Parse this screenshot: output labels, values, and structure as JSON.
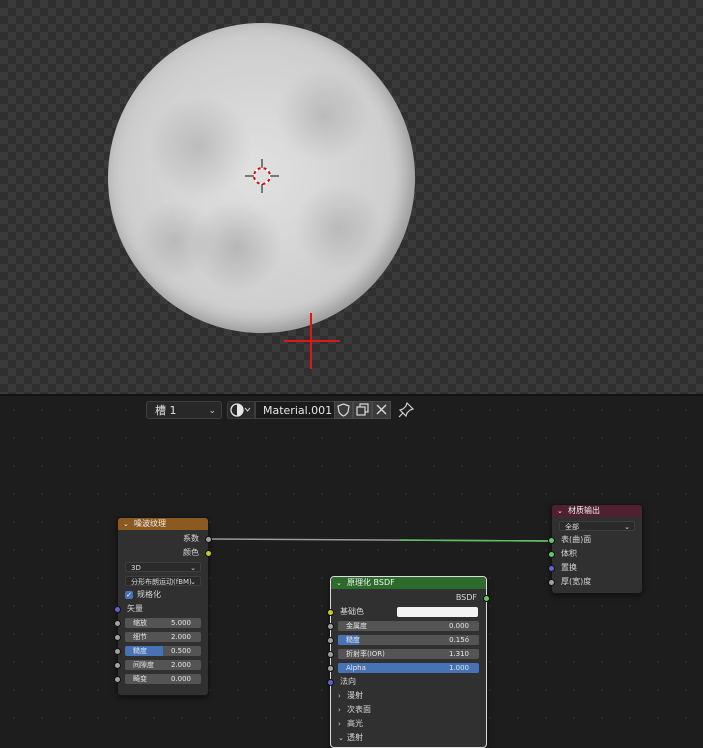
{
  "header": {
    "slot_label": "槽 1",
    "material_name": "Material.001"
  },
  "noise_node": {
    "title": "噪波纹理",
    "outputs": [
      "系数",
      "颜色"
    ],
    "dimension": "3D",
    "noise_type": "分形布朗运动(fBM)",
    "normalize_label": "规格化",
    "normalize_checked": true,
    "vector_label": "矢量",
    "fields": [
      {
        "label": "缩放",
        "value": "5.000"
      },
      {
        "label": "细节",
        "value": "2.000"
      },
      {
        "label": "糙度",
        "value": "0.500",
        "fill": 0.5
      },
      {
        "label": "间隙度",
        "value": "2.000"
      },
      {
        "label": "畸变",
        "value": "0.000"
      }
    ]
  },
  "bsdf_node": {
    "title": "原理化 BSDF",
    "output": "BSDF",
    "base_color_label": "基础色",
    "fields": [
      {
        "label": "金属度",
        "value": "0.000"
      },
      {
        "label": "糙度",
        "value": "0.15ó",
        "fill": 0.15
      },
      {
        "label": "折射率(IOR)",
        "value": "1.310"
      },
      {
        "label": "Alpha",
        "value": "1.000",
        "fill": 1.0
      }
    ],
    "normal_label": "法向",
    "subpanels": [
      "漫射",
      "次表面",
      "高光",
      "透射"
    ]
  },
  "output_node": {
    "title": "材质输出",
    "target": "全部",
    "inputs": [
      "表(曲)面",
      "体积",
      "置换",
      "厚(宽)度"
    ]
  },
  "colors": {
    "noise_header": "#8a5a20",
    "bsdf_header": "#2d6b2d",
    "output_header": "#4e2030",
    "socket_gray": "#a1a1a1",
    "socket_yellow": "#c7c729",
    "socket_green": "#63c763",
    "socket_blue": "#6363c7",
    "link_green": "#5fbf5f"
  }
}
